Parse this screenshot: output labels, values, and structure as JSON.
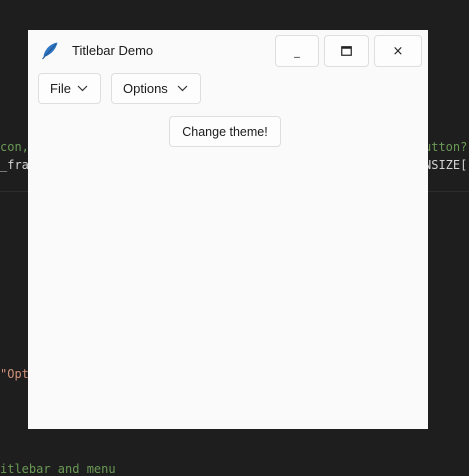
{
  "background_code": {
    "line1_left": "con,",
    "line1_right": "utton?",
    "line2_left": "_fra",
    "line2_right": "NSIZE[",
    "line3_left": "\"Opt",
    "line4_left": "itlebar and menu"
  },
  "window": {
    "title": "Titlebar Demo",
    "app_icon": "feather-icon",
    "controls": {
      "minimize": "_",
      "maximize_icon": "maximize-icon",
      "close": "×"
    }
  },
  "menubar": {
    "file_label": "File",
    "options_label": "Options"
  },
  "content": {
    "change_theme_label": "Change theme!"
  },
  "colors": {
    "editor_bg": "#1e1e1e",
    "window_bg": "#fafafa",
    "icon_blue": "#2f74c0",
    "code_green": "#6a9955",
    "code_orange": "#ce9178",
    "code_white": "#d4d4d4"
  }
}
